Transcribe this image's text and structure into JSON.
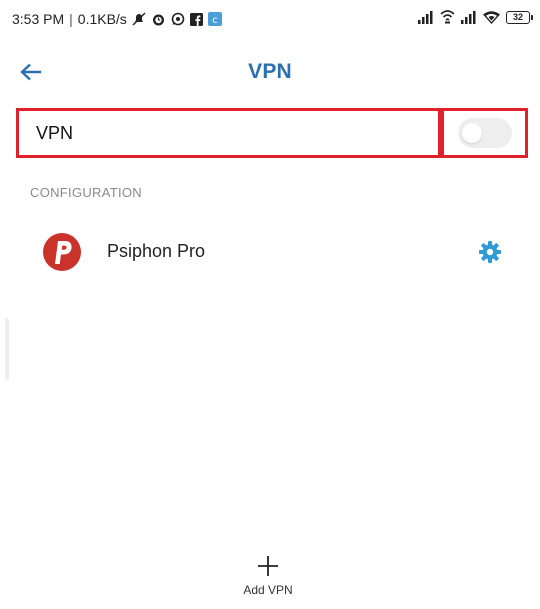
{
  "status_bar": {
    "time": "3:53 PM",
    "separator": "|",
    "network_speed": "0.1KB/s",
    "battery_level": "32",
    "icons": [
      "mute-icon",
      "alarm-icon",
      "whatsapp-icon",
      "facebook-icon",
      "app-notification-icon",
      "signal-icon",
      "hotspot-icon",
      "signal-icon",
      "wifi-icon",
      "battery-icon"
    ]
  },
  "header": {
    "title": "VPN",
    "back_icon": "back-arrow-icon"
  },
  "vpn_toggle": {
    "label": "VPN",
    "enabled": false
  },
  "configuration": {
    "section_title": "CONFIGURATION",
    "items": [
      {
        "name": "Psiphon Pro",
        "logo_letter": "P",
        "logo_color": "#c9332b",
        "action_icon": "gear-icon"
      }
    ]
  },
  "footer": {
    "add_label": "Add VPN",
    "add_icon": "plus-icon"
  },
  "colors": {
    "accent": "#2a6fb0",
    "highlight": "#e0202a",
    "section_text": "#8a8a8a",
    "gear": "#2f9ad6"
  }
}
